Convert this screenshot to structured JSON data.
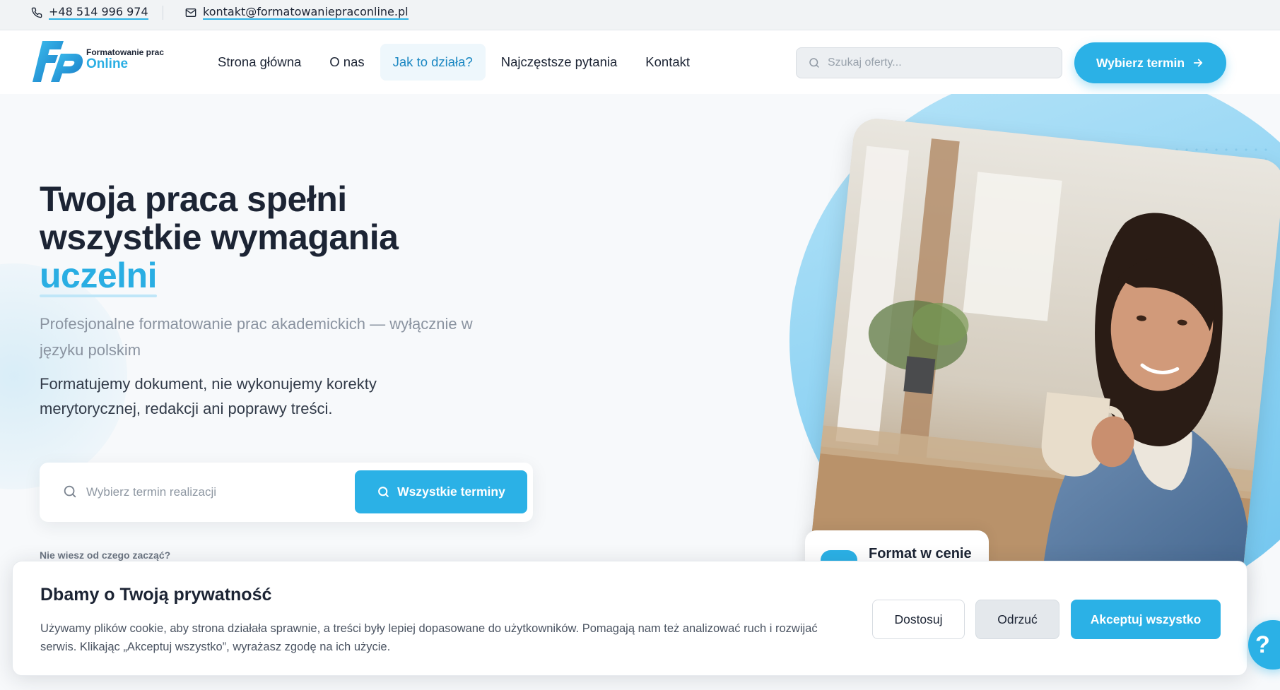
{
  "topbar": {
    "phone": "+48 514 996 974",
    "email": "kontakt@formatowaniepraconline.pl"
  },
  "logo": {
    "line1": "Formatowanie prac",
    "line2": "Online"
  },
  "nav": {
    "items": [
      {
        "label": "Strona główna"
      },
      {
        "label": "O nas"
      },
      {
        "label": "Jak to działa?"
      },
      {
        "label": "Najczęstsze pytania"
      },
      {
        "label": "Kontakt"
      }
    ],
    "active": "Jak to działa?"
  },
  "header_search": {
    "placeholder": "Szukaj oferty..."
  },
  "header_cta": {
    "label": "Wybierz termin"
  },
  "hero": {
    "title_line1": "Twoja praca spełni",
    "title_line2": "wszystkie wymagania",
    "title_accent": "uczelni",
    "subtitle": "Profesjonalne formatowanie prac akademickich — wyłącznie w języku polskim",
    "note": "Formatujemy dokument, nie wykonujemy korekty merytorycznej, redakcji ani poprawy treści.",
    "term_search_placeholder": "Wybierz termin realizacji",
    "term_button": "Wszystkie terminy",
    "hint": "Nie wiesz od czego zacząć?"
  },
  "badge": {
    "text": "Format w cenie"
  },
  "cookie": {
    "title": "Dbamy o Twoją prywatność",
    "text": "Używamy plików cookie, aby strona działała sprawnie, a treści były lepiej dopasowane do użytkowników. Pomagają nam też analizować ruch i rozwijać serwis. Klikając „Akceptuj wszystko”, wyrażasz zgodę na ich użycie.",
    "customize": "Dostosuj",
    "reject": "Odrzuć",
    "accept": "Akceptuj wszystko"
  },
  "help": {
    "label": "?"
  },
  "colors": {
    "accent": "#2bb1e6",
    "text": "#1c2434",
    "muted": "#8a93a0"
  }
}
